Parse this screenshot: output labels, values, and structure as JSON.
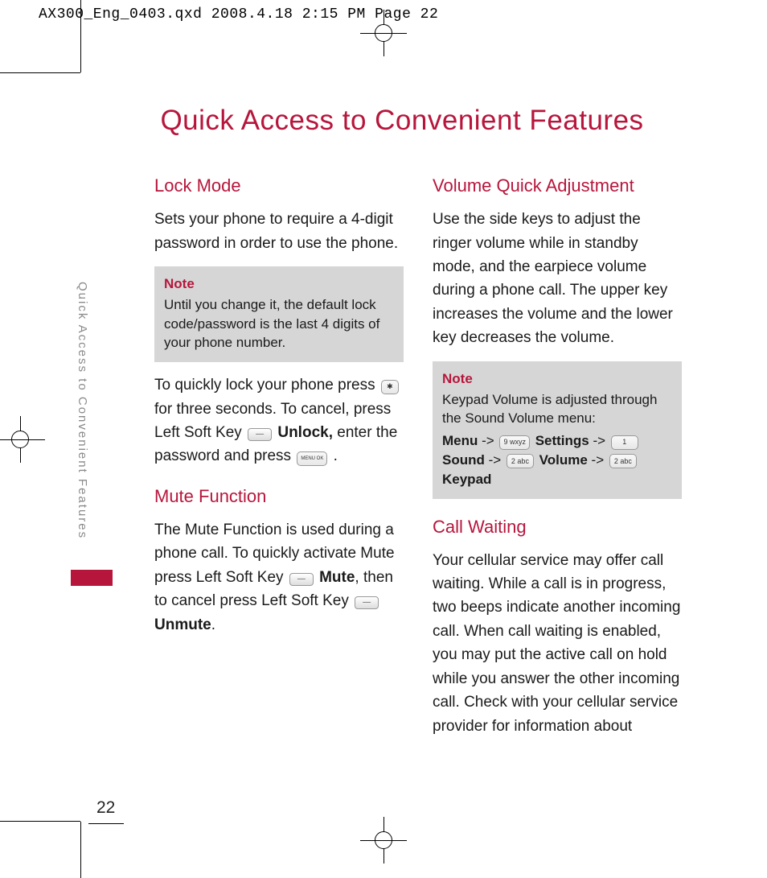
{
  "print_header": "AX300_Eng_0403.qxd  2008.4.18  2:15 PM  Page 22",
  "page_number": "22",
  "side_label": "Quick Access to Convenient Features",
  "title": "Quick Access to Convenient Features",
  "left_col": {
    "lock_mode": {
      "heading": "Lock Mode",
      "intro": "Sets your phone to require a 4-digit password in order to use the phone.",
      "note_title": "Note",
      "note_body": "Until you change it, the default lock code/password is the last 4 digits of your phone number.",
      "body_1": "To quickly lock your phone press ",
      "body_2": " for three seconds. To cancel, press Left Soft Key ",
      "body_3_bold": "Unlock,",
      "body_3_rest": " enter the password and press ",
      "body_4": " ."
    },
    "mute": {
      "heading": "Mute Function",
      "body_1": "The Mute Function is used during a phone call. To quickly activate Mute press Left Soft Key ",
      "body_2_bold": " Mute",
      "body_3": ", then to cancel press Left Soft Key ",
      "body_4_bold": "Unmute",
      "body_5": "."
    }
  },
  "right_col": {
    "volume": {
      "heading": "Volume Quick Adjustment",
      "body": "Use the side keys to adjust the ringer volume while in standby mode, and the earpiece volume during a phone call. The upper key increases the volume and the lower key decreases the volume.",
      "note_title": "Note",
      "note_line1": "Keypad Volume is adjusted through the Sound Volume menu:",
      "menu": {
        "menu_label": "Menu",
        "arrow": " -> ",
        "settings_label": "Settings",
        "sound_label": "Sound",
        "volume_label": "Volume",
        "keypad_label": "Keypad",
        "key9": "9 wxyz",
        "key1": "1",
        "key2a": "2 abc",
        "key2b": "2 abc"
      }
    },
    "call_waiting": {
      "heading": "Call Waiting",
      "body": "Your cellular service may offer call waiting. While a call is in progress, two beeps indicate another incoming call. When call waiting is enabled, you may put the active call on hold while you answer the other incoming call. Check with your cellular service provider for information about"
    }
  },
  "keys": {
    "star": "✱",
    "menu_ok": "MENU OK"
  }
}
